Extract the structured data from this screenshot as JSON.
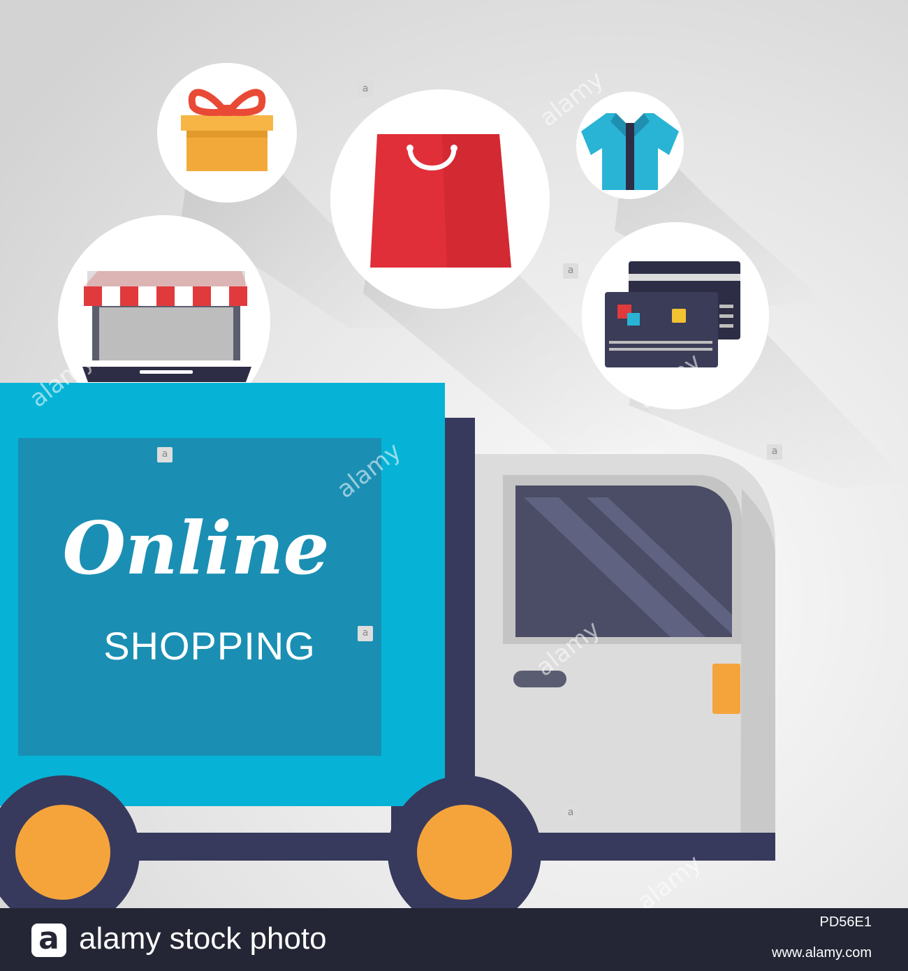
{
  "headline": {
    "script": "Online",
    "sub": "SHOPPING"
  },
  "icons": [
    "gift-box-icon",
    "shopping-bag-icon",
    "shirt-icon",
    "laptop-store-icon",
    "credit-cards-icon",
    "delivery-truck"
  ],
  "watermark": {
    "word": "alamy",
    "letter": "a"
  },
  "stock_bar": {
    "logo_letter": "a",
    "text": "alamy stock photo",
    "image_id": "PD56E1",
    "url": "www.alamy.com"
  },
  "colors": {
    "truck_box": "#06b3d6",
    "truck_panel": "#1a8fb3",
    "truck_chassis": "#373a5d",
    "cab": "#dcdcdc",
    "wheel_rim": "#f5a43c",
    "bag": "#e02f38",
    "shirt": "#29b4d6",
    "gift": "#f7b546",
    "bow": "#e94a36",
    "awning_red": "#e03a3d",
    "stock_bar": "#242635"
  }
}
